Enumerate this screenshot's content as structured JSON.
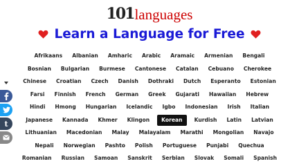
{
  "logo": {
    "number": "101",
    "word": "languages"
  },
  "headline": "Learn a Language for Free",
  "colors": {
    "title": "#1a1ad6",
    "heart": "#e02020",
    "logo_word": "#cc0000",
    "selected_bg": "#111111"
  },
  "selected_language": "Korean",
  "language_rows": [
    [
      "Afrikaans",
      "Albanian",
      "Amharic",
      "Arabic",
      "Aramaic",
      "Armenian",
      "Bengali"
    ],
    [
      "Bosnian",
      "Bulgarian",
      "Burmese",
      "Cantonese",
      "Catalan",
      "Cebuano",
      "Cherokee"
    ],
    [
      "Chinese",
      "Croatian",
      "Czech",
      "Danish",
      "Dothraki",
      "Dutch",
      "Esperanto",
      "Estonian"
    ],
    [
      "Farsi",
      "Finnish",
      "French",
      "German",
      "Greek",
      "Gujarati",
      "Hawaiian",
      "Hebrew"
    ],
    [
      "Hindi",
      "Hmong",
      "Hungarian",
      "Icelandic",
      "Igbo",
      "Indonesian",
      "Irish",
      "Italian"
    ],
    [
      "Japanese",
      "Kannada",
      "Khmer",
      "Klingon",
      "Korean",
      "Kurdish",
      "Latin",
      "Latvian"
    ],
    [
      "Lithuanian",
      "Macedonian",
      "Malay",
      "Malayalam",
      "Marathi",
      "Mongolian",
      "Navajo"
    ],
    [
      "Nepali",
      "Norwegian",
      "Pashto",
      "Polish",
      "Portuguese",
      "Punjabi",
      "Quechua"
    ],
    [
      "Romanian",
      "Russian",
      "Samoan",
      "Sanskrit",
      "Serbian",
      "Slovak",
      "Somali",
      "Spanish"
    ]
  ],
  "share": {
    "icons": [
      "facebook-icon",
      "twitter-icon",
      "tumblr-icon",
      "email-icon"
    ],
    "colors": [
      "#3b5998",
      "#1da1f2",
      "#35465c",
      "#888888"
    ]
  }
}
